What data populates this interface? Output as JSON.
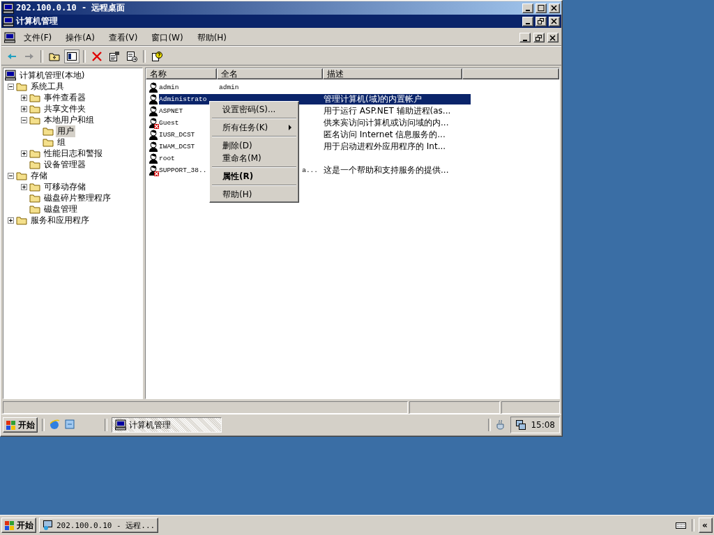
{
  "remote_window": {
    "title": "202.100.0.10 - 远程桌面"
  },
  "app_window": {
    "title": "计算机管理"
  },
  "menu": [
    {
      "label": "文件(F)"
    },
    {
      "label": "操作(A)"
    },
    {
      "label": "查看(V)"
    },
    {
      "label": "窗口(W)"
    },
    {
      "label": "帮助(H)"
    }
  ],
  "tree": {
    "label": "计算机管理(本地)",
    "selected": false,
    "children": [
      {
        "label": "系统工具",
        "selected": false,
        "expanded": true,
        "children": [
          {
            "label": "事件查看器",
            "selected": false,
            "expanded": false
          },
          {
            "label": "共享文件夹",
            "selected": false,
            "expanded": false
          },
          {
            "label": "本地用户和组",
            "selected": false,
            "expanded": true,
            "children": [
              {
                "label": "用户",
                "selected": true
              },
              {
                "label": "组",
                "selected": false
              }
            ]
          },
          {
            "label": "性能日志和警报",
            "selected": false,
            "expanded": false
          },
          {
            "label": "设备管理器",
            "selected": false
          }
        ]
      },
      {
        "label": "存储",
        "selected": false,
        "expanded": true,
        "children": [
          {
            "label": "可移动存储",
            "selected": false,
            "expanded": false
          },
          {
            "label": "磁盘碎片整理程序",
            "selected": false
          },
          {
            "label": "磁盘管理",
            "selected": false
          }
        ]
      },
      {
        "label": "服务和应用程序",
        "selected": false,
        "expanded": false
      }
    ]
  },
  "columns": [
    "名称",
    "全名",
    "描述"
  ],
  "rows": [
    {
      "name": "admin",
      "full_name": "admin",
      "description": "",
      "disabled": false,
      "selected": false
    },
    {
      "name": "Administrato",
      "full_name": "",
      "description": "管理计算机(域)的内置帐户",
      "disabled": false,
      "selected": true
    },
    {
      "name": "ASPNET",
      "full_name": "",
      "description": "用于运行 ASP.NET 辅助进程(as...",
      "disabled": false,
      "selected": false
    },
    {
      "name": "Guest",
      "full_name": "",
      "description": "供来宾访问计算机或访问域的内...",
      "disabled": true,
      "selected": false
    },
    {
      "name": "IUSR_DCST",
      "full_name": "",
      "description": "匿名访问 Internet 信息服务的...",
      "disabled": false,
      "selected": false
    },
    {
      "name": "IWAM_DCST",
      "full_name": "",
      "description": "用于启动进程外应用程序的 Int...",
      "disabled": false,
      "selected": false
    },
    {
      "name": "root",
      "full_name": "",
      "description": "",
      "disabled": false,
      "selected": false
    },
    {
      "name": "SUPPORT_38..",
      "full_name": "a...",
      "description": "这是一个帮助和支持服务的提供...",
      "disabled": true,
      "selected": false
    }
  ],
  "context_menu": [
    {
      "kind": "item",
      "label": "设置密码(S)...",
      "submenu": false,
      "default": false
    },
    {
      "kind": "separator"
    },
    {
      "kind": "item",
      "label": "所有任务(K)",
      "submenu": true,
      "default": false
    },
    {
      "kind": "separator"
    },
    {
      "kind": "item",
      "label": "删除(D)",
      "submenu": false,
      "default": false
    },
    {
      "kind": "item",
      "label": "重命名(M)",
      "submenu": false,
      "default": false
    },
    {
      "kind": "separator"
    },
    {
      "kind": "item",
      "label": "属性(R)",
      "submenu": false,
      "default": true
    },
    {
      "kind": "separator"
    },
    {
      "kind": "item",
      "label": "帮助(H)",
      "submenu": false,
      "default": false
    }
  ],
  "remote_taskbar": {
    "start": "开始",
    "tasks": [
      {
        "label": "计算机管理",
        "selected": true
      }
    ],
    "clock": "15:08"
  },
  "taskbar": {
    "start": "开始",
    "tasks": [
      {
        "label": "202.100.0.10 - 远程...",
        "selected": false
      }
    ],
    "collapse": "«"
  }
}
